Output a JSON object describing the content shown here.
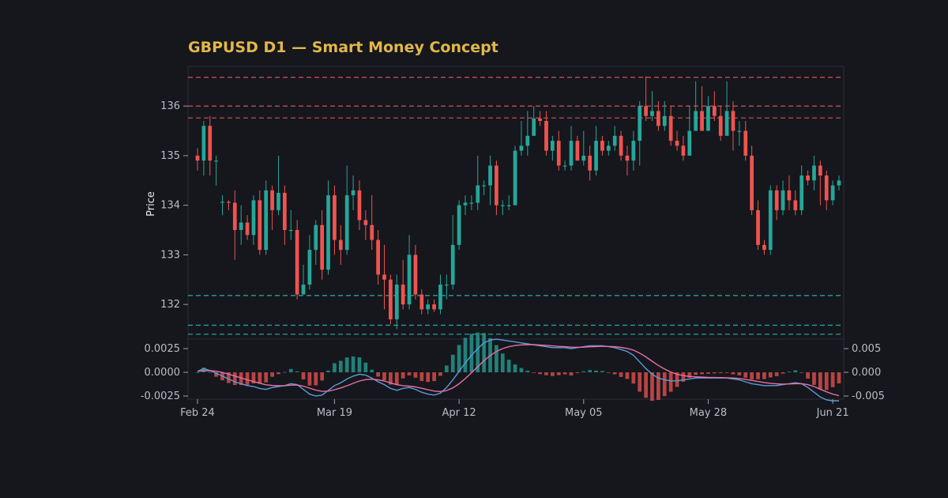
{
  "chart_data": {
    "type": "candlestick",
    "title": "GBPUSD D1 — Smart Money Concept",
    "ylabel": "Price",
    "price_ylim": [
      131.3,
      136.8
    ],
    "price_ticks": [
      "132",
      "133",
      "134",
      "135",
      "136"
    ],
    "date_ticks": [
      {
        "index": 0,
        "label": "Feb 24"
      },
      {
        "index": 22,
        "label": "Mar 19"
      },
      {
        "index": 42,
        "label": "Apr 12"
      },
      {
        "index": 62,
        "label": "May 05"
      },
      {
        "index": 82,
        "label": "May 28"
      },
      {
        "index": 102,
        "label": "Jun 21"
      }
    ],
    "resistance_levels": [
      136.58,
      136.0,
      135.76
    ],
    "support_levels": [
      132.18,
      131.58,
      131.4
    ],
    "candles": [
      [
        135.0,
        134.9,
        135.15,
        134.7
      ],
      [
        134.9,
        135.6,
        135.7,
        134.6
      ],
      [
        135.6,
        134.9,
        135.8,
        134.6
      ],
      [
        134.9,
        134.9,
        135.0,
        134.4
      ],
      [
        134.05,
        134.07,
        134.2,
        133.8
      ],
      [
        134.07,
        134.05,
        134.1,
        133.9
      ],
      [
        134.05,
        133.5,
        134.3,
        132.9
      ],
      [
        133.5,
        133.65,
        134.0,
        133.2
      ],
      [
        133.65,
        133.4,
        133.8,
        133.3
      ],
      [
        133.4,
        134.1,
        134.2,
        133.2
      ],
      [
        134.1,
        133.1,
        134.3,
        133.0
      ],
      [
        133.1,
        134.3,
        134.5,
        133.0
      ],
      [
        134.3,
        133.9,
        134.4,
        133.5
      ],
      [
        133.9,
        134.25,
        135.0,
        133.8
      ],
      [
        134.25,
        133.5,
        134.4,
        133.2
      ],
      [
        133.5,
        133.5,
        133.9,
        133.3
      ],
      [
        133.5,
        132.2,
        133.7,
        132.1
      ],
      [
        132.2,
        132.4,
        132.8,
        132.2
      ],
      [
        132.4,
        133.1,
        133.4,
        132.3
      ],
      [
        133.1,
        133.6,
        133.7,
        132.8
      ],
      [
        133.6,
        132.7,
        133.9,
        132.5
      ],
      [
        132.7,
        134.2,
        134.5,
        132.6
      ],
      [
        134.2,
        133.3,
        134.4,
        133.0
      ],
      [
        133.3,
        133.1,
        133.6,
        132.8
      ],
      [
        133.1,
        134.2,
        134.8,
        133.0
      ],
      [
        134.2,
        134.3,
        134.6,
        133.9
      ],
      [
        134.3,
        133.7,
        134.5,
        133.5
      ],
      [
        133.7,
        133.6,
        133.9,
        133.3
      ],
      [
        133.6,
        133.3,
        134.2,
        133.1
      ],
      [
        133.3,
        132.6,
        133.5,
        132.4
      ],
      [
        132.6,
        132.5,
        133.2,
        131.9
      ],
      [
        132.5,
        131.7,
        132.6,
        131.6
      ],
      [
        131.7,
        132.4,
        132.6,
        131.5
      ],
      [
        132.4,
        132.0,
        132.9,
        131.9
      ],
      [
        132.0,
        133.0,
        133.4,
        131.9
      ],
      [
        133.0,
        132.2,
        133.2,
        132.1
      ],
      [
        132.2,
        131.9,
        132.3,
        131.8
      ],
      [
        131.9,
        132.0,
        132.1,
        131.8
      ],
      [
        132.0,
        131.9,
        132.1,
        131.85
      ],
      [
        131.9,
        132.4,
        132.6,
        131.8
      ],
      [
        132.4,
        132.4,
        132.6,
        132.1
      ],
      [
        132.4,
        133.2,
        133.8,
        132.3
      ],
      [
        133.2,
        134.0,
        134.1,
        133.1
      ],
      [
        134.0,
        134.05,
        134.2,
        133.8
      ],
      [
        134.05,
        134.05,
        134.2,
        133.9
      ],
      [
        134.05,
        134.4,
        135.0,
        133.9
      ],
      [
        134.4,
        134.4,
        134.5,
        134.2
      ],
      [
        134.4,
        134.8,
        135.0,
        134.0
      ],
      [
        134.8,
        134.0,
        134.9,
        133.8
      ],
      [
        134.0,
        134.0,
        134.1,
        133.8
      ],
      [
        134.0,
        134.0,
        134.2,
        133.9
      ],
      [
        134.0,
        135.1,
        135.2,
        134.8
      ],
      [
        135.1,
        135.2,
        135.7,
        135.0
      ],
      [
        135.2,
        135.4,
        135.9,
        135.0
      ],
      [
        135.4,
        135.75,
        136.0,
        135.4
      ],
      [
        135.75,
        135.7,
        135.9,
        135.6
      ],
      [
        135.7,
        135.1,
        135.9,
        135.0
      ],
      [
        135.1,
        135.3,
        135.4,
        134.9
      ],
      [
        135.3,
        134.8,
        135.5,
        134.7
      ],
      [
        134.8,
        134.8,
        134.9,
        134.7
      ],
      [
        134.8,
        135.3,
        135.6,
        134.7
      ],
      [
        135.3,
        134.9,
        135.4,
        134.9
      ],
      [
        134.9,
        135.0,
        135.5,
        134.8
      ],
      [
        135.0,
        134.7,
        135.2,
        134.5
      ],
      [
        134.7,
        135.3,
        135.6,
        134.6
      ],
      [
        135.3,
        135.1,
        135.4,
        135.0
      ],
      [
        135.1,
        135.2,
        135.3,
        135.0
      ],
      [
        135.2,
        135.4,
        135.6,
        135.1
      ],
      [
        135.4,
        135.0,
        135.5,
        134.9
      ],
      [
        135.0,
        134.9,
        135.2,
        134.6
      ],
      [
        134.9,
        135.3,
        135.5,
        134.7
      ],
      [
        135.3,
        136.0,
        136.1,
        134.8
      ],
      [
        136.0,
        135.8,
        136.6,
        135.7
      ],
      [
        135.8,
        135.9,
        136.3,
        135.7
      ],
      [
        135.9,
        135.6,
        136.1,
        135.5
      ],
      [
        135.6,
        135.8,
        136.1,
        135.5
      ],
      [
        135.8,
        135.3,
        136.0,
        135.2
      ],
      [
        135.3,
        135.2,
        135.5,
        135.1
      ],
      [
        135.2,
        135.0,
        135.4,
        134.9
      ],
      [
        135.0,
        135.5,
        136.0,
        135.0
      ],
      [
        135.5,
        135.9,
        136.5,
        135.6
      ],
      [
        135.9,
        135.5,
        136.4,
        135.5
      ],
      [
        135.5,
        136.0,
        136.2,
        135.5
      ],
      [
        136.0,
        135.8,
        136.3,
        135.7
      ],
      [
        135.8,
        135.4,
        136.0,
        135.3
      ],
      [
        135.4,
        135.9,
        136.5,
        135.4
      ],
      [
        135.9,
        135.5,
        136.1,
        135.1
      ],
      [
        135.5,
        135.5,
        135.7,
        135.2
      ],
      [
        135.5,
        135.0,
        135.7,
        134.9
      ],
      [
        135.0,
        133.9,
        135.2,
        133.8
      ],
      [
        133.9,
        133.2,
        134.1,
        133.1
      ],
      [
        133.2,
        133.1,
        133.3,
        133.0
      ],
      [
        133.1,
        134.3,
        134.4,
        133.0
      ],
      [
        134.3,
        133.9,
        134.4,
        133.7
      ],
      [
        133.9,
        134.3,
        134.5,
        133.8
      ],
      [
        134.3,
        134.1,
        134.6,
        133.9
      ],
      [
        134.1,
        133.9,
        134.3,
        133.8
      ],
      [
        133.9,
        134.6,
        134.8,
        133.8
      ],
      [
        134.6,
        134.5,
        134.7,
        134.4
      ],
      [
        134.5,
        134.8,
        135.0,
        134.3
      ],
      [
        134.8,
        134.6,
        134.9,
        134.0
      ],
      [
        134.6,
        134.1,
        134.7,
        133.9
      ],
      [
        134.1,
        134.4,
        134.5,
        134.0
      ],
      [
        134.4,
        134.5,
        134.6,
        134.3
      ]
    ],
    "macd": [
      {
        "name": "MACD",
        "color": "#5b9bd8",
        "values": [
          0.0002,
          0.0008,
          0.0004,
          -0.0002,
          -0.0008,
          -0.0014,
          -0.002,
          -0.0024,
          -0.0028,
          -0.003,
          -0.0034,
          -0.0036,
          -0.0032,
          -0.003,
          -0.0028,
          -0.0024,
          -0.0026,
          -0.0036,
          -0.0046,
          -0.005,
          -0.0048,
          -0.0038,
          -0.0028,
          -0.0022,
          -0.0014,
          -0.0008,
          -0.0004,
          -0.0006,
          -0.0012,
          -0.002,
          -0.0026,
          -0.0034,
          -0.0038,
          -0.0034,
          -0.0032,
          -0.0036,
          -0.0042,
          -0.0046,
          -0.0048,
          -0.0044,
          -0.0032,
          -0.0016,
          0.0002,
          0.002,
          0.0036,
          0.005,
          0.0062,
          0.0068,
          0.007,
          0.0068,
          0.0066,
          0.0064,
          0.0062,
          0.006,
          0.0058,
          0.0056,
          0.0054,
          0.0052,
          0.0052,
          0.0052,
          0.005,
          0.0052,
          0.0054,
          0.0056,
          0.0056,
          0.0056,
          0.0054,
          0.0052,
          0.0048,
          0.0044,
          0.0036,
          0.0022,
          0.0008,
          -0.0004,
          -0.0012,
          -0.0016,
          -0.0018,
          -0.0018,
          -0.0016,
          -0.0014,
          -0.0012,
          -0.0012,
          -0.0012,
          -0.0012,
          -0.0012,
          -0.0012,
          -0.0014,
          -0.0016,
          -0.002,
          -0.0024,
          -0.0026,
          -0.0028,
          -0.0028,
          -0.0028,
          -0.0026,
          -0.0024,
          -0.0022,
          -0.0024,
          -0.0032,
          -0.0042,
          -0.0052,
          -0.0058,
          -0.006,
          -0.006
        ]
      }
    ],
    "macd_note": "MACD panel: histogram, MACD line (blue) and signal line (pink)",
    "macd_left_ticks": [
      "0.0025",
      "0.0000",
      "-0.0025"
    ],
    "macd_right_ticks": [
      "0.005",
      "0.000",
      "-0.005"
    ]
  }
}
